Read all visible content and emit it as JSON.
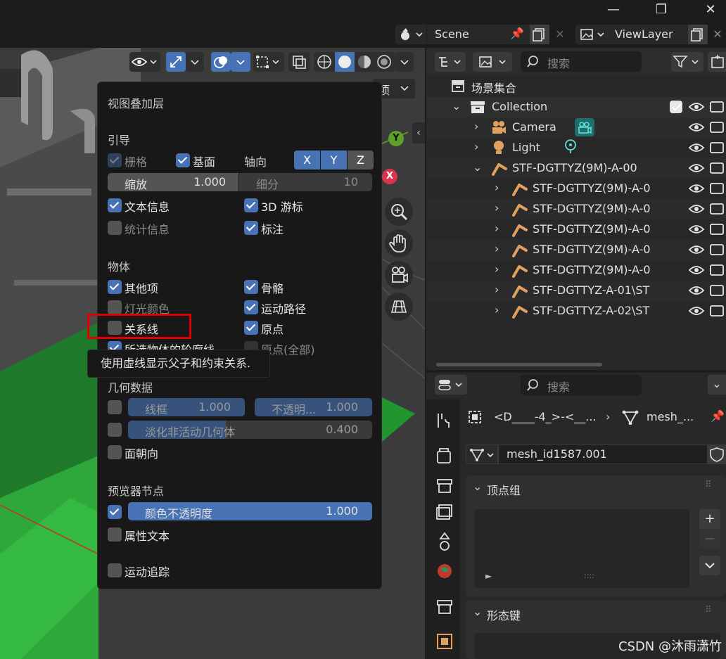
{
  "window": {
    "scene_label": "Scene",
    "viewlayer_label": "ViewLayer",
    "minimize": "—",
    "restore": "❐",
    "close": "✕"
  },
  "viewport": {
    "right_label": "项",
    "gizmo": {
      "y": "Y",
      "x": "X"
    }
  },
  "overlay_popup": {
    "title": "视图叠加层",
    "guides": {
      "title": "引导",
      "grid": "栅格",
      "floor": "基面",
      "axes": "轴向",
      "axis_buttons": [
        "X",
        "Y",
        "Z"
      ],
      "scale_label": "缩放",
      "scale_value": "1.000",
      "subdivision_label": "细分",
      "subdivision_value": "10",
      "text_info": "文本信息",
      "cursor_3d": "3D 游标",
      "statistics": "统计信息",
      "annotations": "标注"
    },
    "objects": {
      "title": "物体",
      "extras": "其他项",
      "bones": "骨骼",
      "light_colors": "灯光颜色",
      "motion_paths": "运动路径",
      "relationship_lines": "关系线",
      "origins": "原点",
      "outline_selected": "所选物体的轮廓线",
      "origins_all": "原点(全部)"
    },
    "tooltip": "使用虚线显示父子和约束关系.",
    "geometry": {
      "title": "几何数据",
      "wireframe_label": "线框",
      "wireframe_value": "1.000",
      "opacity_label": "不透明...",
      "opacity_value": "1.000",
      "fade_label": "淡化非活动几何体",
      "fade_value": "0.400",
      "face_orientation": "面朝向"
    },
    "viewer_node": {
      "title": "预览器节点",
      "color_opacity_label": "颜色不透明度",
      "color_opacity_value": "1.000",
      "attribute_text": "属性文本"
    },
    "motion_tracking": "运动追踪"
  },
  "outliner": {
    "search_placeholder": "搜索",
    "scene_collection": "场景集合",
    "items": [
      {
        "label": "Collection",
        "type": "collection"
      },
      {
        "label": "Camera",
        "type": "camera"
      },
      {
        "label": "Light",
        "type": "light"
      },
      {
        "label": "STF-DGTTYZ(9M)-A-00",
        "type": "armature"
      },
      {
        "label": "STF-DGTTYZ(9M)-A-0",
        "type": "armature"
      },
      {
        "label": "STF-DGTTYZ(9M)-A-0",
        "type": "armature"
      },
      {
        "label": "STF-DGTTYZ(9M)-A-0",
        "type": "armature"
      },
      {
        "label": "STF-DGTTYZ(9M)-A-0",
        "type": "armature"
      },
      {
        "label": "STF-DGTTYZ(9M)-A-0",
        "type": "armature"
      },
      {
        "label": "STF-DGTTYZ-A-01\\ST",
        "type": "armature"
      },
      {
        "label": "STF-DGTTYZ-A-02\\ST",
        "type": "armature"
      }
    ]
  },
  "properties": {
    "search_placeholder": "搜索",
    "breadcrumb_object": "<D____-4_>-<__...",
    "breadcrumb_mesh": "mesh_...",
    "mesh_name": "mesh_id1587.001",
    "vertex_groups": "顶点组",
    "shape_keys": "形态键",
    "add": "+",
    "remove": "—",
    "dropdown": "⌄"
  },
  "watermark": "CSDN @沐雨潇竹",
  "colors": {
    "accent": "#4772b3",
    "highlight_box": "#e00000",
    "green_mesh": "#2ea83a"
  }
}
